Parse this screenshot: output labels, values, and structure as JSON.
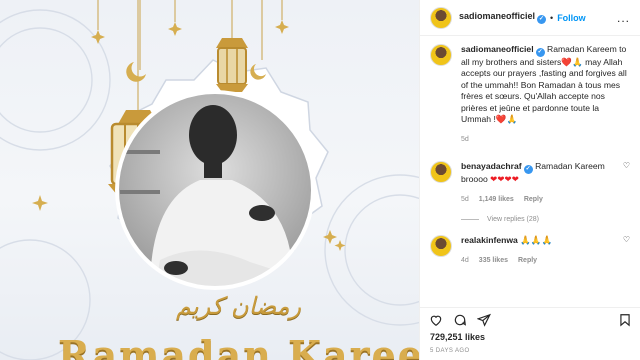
{
  "post": {
    "arabic_text": "رمضان كريم",
    "title_text": "Ramadan Kareem"
  },
  "header": {
    "username": "sadiomaneofficiel",
    "dot": "•",
    "follow_label": "Follow",
    "more": "..."
  },
  "caption": {
    "username": "sadiomaneofficiel",
    "text": "Ramadan Kareem to all my brothers and sisters",
    "text2": "may Allah accepts our prayers ,fasting and forgives all of the ummah!! Bon Ramadan à tous mes frères et sœurs. Qu'Allah accepte nos prières et jeûne et pardonne toute la Ummah !",
    "emoji1": "❤️",
    "emoji2": "🙏",
    "time": "5d"
  },
  "comments": [
    {
      "username": "benayadachraf",
      "text": "Ramadan Kareem broooo",
      "hearts": "❤❤❤❤",
      "time": "5d",
      "likes": "1,149 likes",
      "reply": "Reply",
      "view_replies": "View replies (28)"
    },
    {
      "username": "realakinfenwa",
      "text": "🙏🙏🙏",
      "time": "4d",
      "likes": "335 likes",
      "reply": "Reply"
    }
  ],
  "likes_count": "729,251 likes",
  "date": "5 DAYS AGO",
  "colors": {
    "accent": "#0095f6",
    "verified": "#3897f0",
    "gold": "#d9ad4e"
  },
  "icons": [
    "heart-icon",
    "comment-icon",
    "share-icon",
    "bookmark-icon"
  ]
}
